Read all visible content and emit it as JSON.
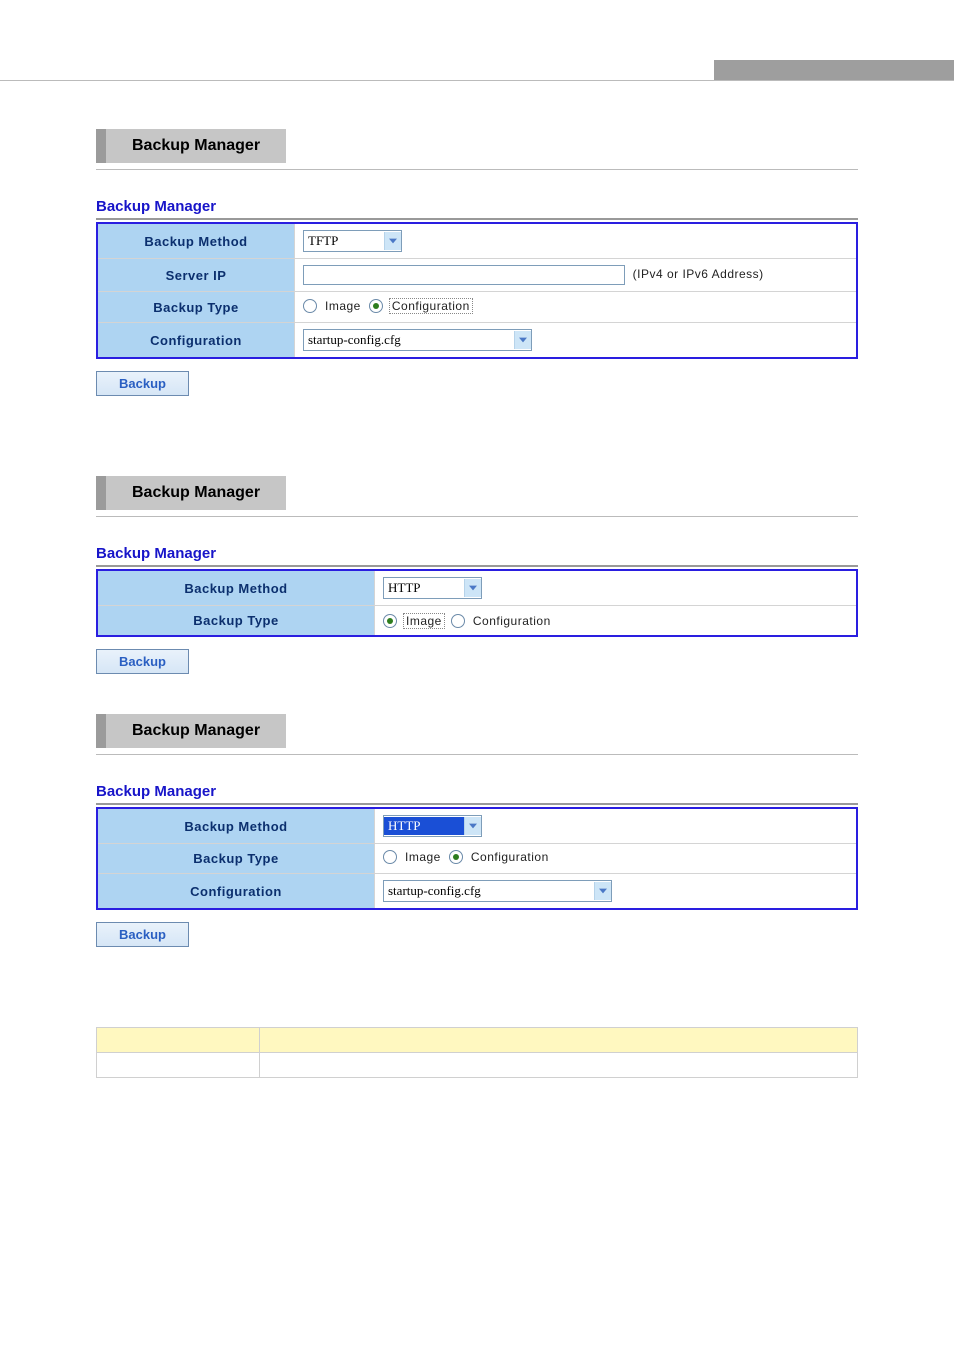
{
  "sections": {
    "s1": {
      "header": "Backup Manager",
      "subtitle": "Backup Manager",
      "rows": {
        "method_label": "Backup Method",
        "method_value": "TFTP",
        "serverip_label": "Server IP",
        "serverip_hint": "(IPv4 or IPv6 Address)",
        "type_label": "Backup Type",
        "type_opt1": "Image",
        "type_opt2": "Configuration",
        "config_label": "Configuration",
        "config_value": "startup-config.cfg"
      },
      "button": "Backup"
    },
    "s2": {
      "header": "Backup Manager",
      "subtitle": "Backup Manager",
      "rows": {
        "method_label": "Backup Method",
        "method_value": "HTTP",
        "type_label": "Backup Type",
        "type_opt1": "Image",
        "type_opt2": "Configuration"
      },
      "button": "Backup"
    },
    "s3": {
      "header": "Backup Manager",
      "subtitle": "Backup Manager",
      "rows": {
        "method_label": "Backup Method",
        "method_value": "HTTP",
        "type_label": "Backup Type",
        "type_opt1": "Image",
        "type_opt2": "Configuration",
        "config_label": "Configuration",
        "config_value": "startup-config.cfg"
      },
      "button": "Backup"
    }
  }
}
